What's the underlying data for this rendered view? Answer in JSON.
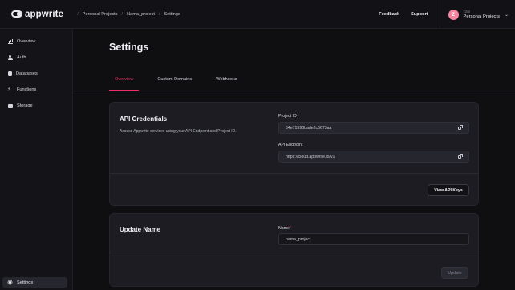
{
  "app": {
    "logo_text": "appwrite"
  },
  "breadcrumbs": [
    "Personal Projects",
    "Nama_project",
    "Settings"
  ],
  "breadcrumb_separator": "/",
  "header": {
    "feedback_label": "Feedback",
    "support_label": "Support",
    "user": {
      "avatar_initial": "Z",
      "name": "zzul",
      "organization": "Personal Projects"
    }
  },
  "sidebar": {
    "items": [
      {
        "label": "Overview",
        "icon": "bar-chart-icon"
      },
      {
        "label": "Auth",
        "icon": "users-icon"
      },
      {
        "label": "Databases",
        "icon": "database-icon"
      },
      {
        "label": "Functions",
        "icon": "lightning-icon"
      },
      {
        "label": "Storage",
        "icon": "folder-icon"
      }
    ],
    "settings_label": "Settings"
  },
  "page": {
    "title": "Settings",
    "tabs": [
      {
        "label": "Overview",
        "active": true
      },
      {
        "label": "Custom Domains",
        "active": false
      },
      {
        "label": "Webhooks",
        "active": false
      }
    ]
  },
  "api_credentials": {
    "title": "API Credentials",
    "description": "Access Appwrite services using your API Endpoint and Project ID.",
    "project_id_label": "Project ID",
    "project_id_value": "64e71590bade2c6673aa",
    "endpoint_label": "API Endpoint",
    "endpoint_value": "https://cloud.appwrite.io/v1",
    "view_keys_label": "View API Keys"
  },
  "update_name": {
    "title": "Update Name",
    "name_label": "Name",
    "required_mark": "*",
    "name_value": "nama_project",
    "update_label": "Update"
  },
  "colors": {
    "accent": "#f02e65",
    "avatar": "#f5849f",
    "background": "#0f0f12",
    "card": "#1c1c22"
  }
}
